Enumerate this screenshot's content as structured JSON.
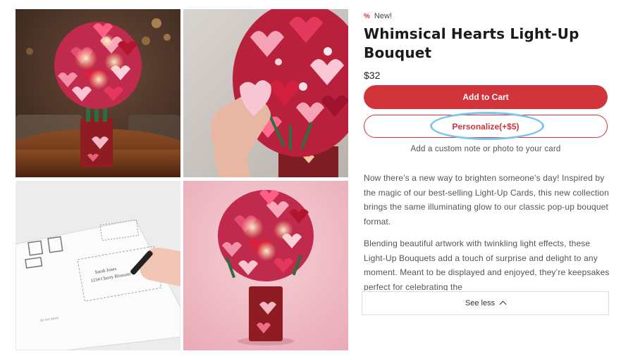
{
  "gallery": {
    "images": [
      {
        "alt": "Light-up bouquet card on wooden table in living room"
      },
      {
        "alt": "Hand holding a heart from the bouquet"
      },
      {
        "alt": "Hand writing on the back of the postcard"
      },
      {
        "alt": "Light-up bouquet on pink background"
      }
    ],
    "postcard": {
      "name_line": "Sarah Jones",
      "address_line": "1234 Cherry Blossom",
      "footer": "do not bend"
    }
  },
  "product": {
    "badge": "New!",
    "title_line1": "Whimsical Hearts Light-Up",
    "title_line2": "Bouquet",
    "price": "$32",
    "add_to_cart": "Add to Cart",
    "personalize": "Personalize(+$5)",
    "note": "Add a custom note or photo to your card",
    "description": [
      "Now there’s a new way to brighten someone’s day! Inspired by the magic of our best-selling Light-Up Cards, this new collection brings the same illuminating glow to our classic pop-up bouquet format.",
      "Blending beautiful artwork with twinkling light effects, these Light-Up Bouquets add a touch of surprise and delight to any moment. Meant to be displayed and enjoyed, they’re keepsakes perfect for celebrating the"
    ],
    "see_less": "See less"
  },
  "colors": {
    "accent": "#d1343b",
    "highlight_ring": "#7cc4f0"
  },
  "icons": {
    "badge": "percent-icon",
    "see_less": "chevron-up-icon"
  }
}
